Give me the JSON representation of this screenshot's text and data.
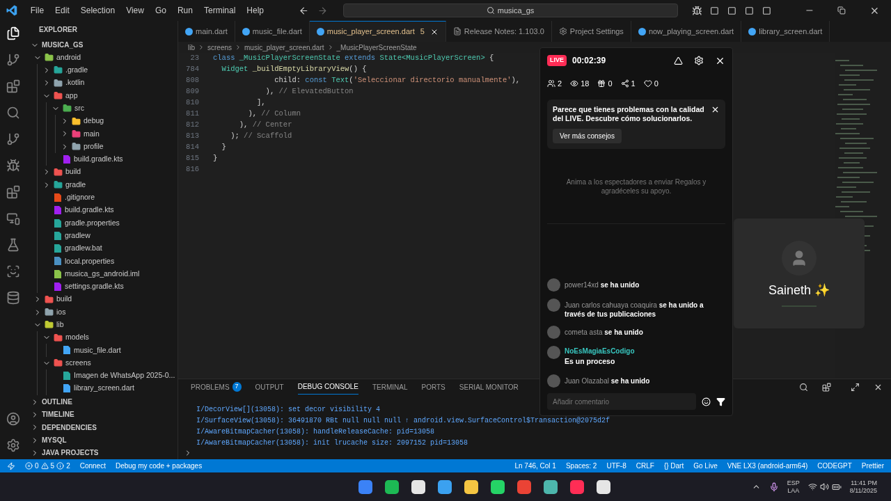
{
  "menu": [
    "File",
    "Edit",
    "Selection",
    "View",
    "Go",
    "Run",
    "Terminal",
    "Help"
  ],
  "search": {
    "value": "musica_gs"
  },
  "tabs": [
    {
      "label": "main.dart",
      "kind": "dart",
      "selected": false
    },
    {
      "label": "music_file.dart",
      "kind": "dart",
      "selected": false
    },
    {
      "label": "music_player_screen.dart",
      "kind": "dart",
      "selected": true,
      "badge": "5"
    },
    {
      "label": "Release Notes: 1.103.0",
      "kind": "doc",
      "selected": false
    },
    {
      "label": "Project Settings",
      "kind": "settings",
      "selected": false
    },
    {
      "label": "now_playing_screen.dart",
      "kind": "dart",
      "selected": false
    },
    {
      "label": "library_screen.dart",
      "kind": "dart",
      "selected": false
    }
  ],
  "explorer": {
    "title": "EXPLORER",
    "root": "MUSICA_GS",
    "tree": [
      {
        "name": "android",
        "kind": "folder",
        "expanded": true,
        "color": "#8bc34a",
        "children": [
          {
            "name": ".gradle",
            "kind": "folder",
            "expanded": false,
            "color": "#26a69a"
          },
          {
            "name": ".kotlin",
            "kind": "folder",
            "expanded": false,
            "color": "#90a4ae"
          },
          {
            "name": "app",
            "kind": "folder",
            "expanded": true,
            "color": "#ef5350",
            "children": [
              {
                "name": "src",
                "kind": "folder",
                "expanded": true,
                "color": "#4caf50",
                "children": [
                  {
                    "name": "debug",
                    "kind": "folder",
                    "expanded": false,
                    "color": "#fbc02d"
                  },
                  {
                    "name": "main",
                    "kind": "folder",
                    "expanded": false,
                    "color": "#ec407a"
                  },
                  {
                    "name": "profile",
                    "kind": "folder",
                    "expanded": false,
                    "color": "#90a4ae"
                  }
                ]
              },
              {
                "name": "build.gradle.kts",
                "kind": "file",
                "color": "#a020f0"
              }
            ]
          },
          {
            "name": "build",
            "kind": "folder",
            "expanded": false,
            "color": "#ef5350"
          },
          {
            "name": "gradle",
            "kind": "folder",
            "expanded": false,
            "color": "#26a69a"
          },
          {
            "name": ".gitignore",
            "kind": "file",
            "color": "#e64a19"
          },
          {
            "name": "build.gradle.kts",
            "kind": "file",
            "color": "#a020f0"
          },
          {
            "name": "gradle.properties",
            "kind": "file",
            "color": "#26a69a"
          },
          {
            "name": "gradlew",
            "kind": "file",
            "color": "#26a69a"
          },
          {
            "name": "gradlew.bat",
            "kind": "file",
            "color": "#26a69a"
          },
          {
            "name": "local.properties",
            "kind": "file",
            "color": "#4a90c2"
          },
          {
            "name": "musica_gs_android.iml",
            "kind": "file",
            "color": "#8bc34a"
          },
          {
            "name": "settings.gradle.kts",
            "kind": "file",
            "color": "#a020f0"
          }
        ]
      },
      {
        "name": "build",
        "kind": "folder",
        "expanded": false,
        "color": "#ef5350"
      },
      {
        "name": "ios",
        "kind": "folder",
        "expanded": false,
        "color": "#90a4ae"
      },
      {
        "name": "lib",
        "kind": "folder",
        "expanded": true,
        "color": "#c0ca33",
        "children": [
          {
            "name": "models",
            "kind": "folder",
            "expanded": true,
            "color": "#ef5350",
            "children": [
              {
                "name": "music_file.dart",
                "kind": "file",
                "color": "#42a5f5"
              }
            ]
          },
          {
            "name": "screens",
            "kind": "folder",
            "expanded": true,
            "color": "#ef5350",
            "children": [
              {
                "name": "Imagen de WhatsApp 2025-0...",
                "kind": "file",
                "color": "#26a69a"
              },
              {
                "name": "library_screen.dart",
                "kind": "file",
                "color": "#42a5f5"
              }
            ]
          }
        ]
      }
    ],
    "sections": [
      "OUTLINE",
      "TIMELINE",
      "DEPENDENCIES",
      "MYSQL",
      "JAVA PROJECTS"
    ]
  },
  "breadcrumb": [
    "lib",
    "screens",
    "music_player_screen.dart",
    "_MusicPlayerScreenState"
  ],
  "code": [
    {
      "number": "23",
      "tokens": [
        {
          "text": "class ",
          "kind": "keyword"
        },
        {
          "text": "_MusicPlayerScreenState ",
          "kind": "type"
        },
        {
          "text": "extends ",
          "kind": "keyword"
        },
        {
          "text": "State<MusicPlayerScreen> ",
          "kind": "type"
        },
        {
          "text": "{",
          "kind": "plain"
        }
      ]
    },
    {
      "number": "784",
      "tokens": [
        {
          "text": "  Widget ",
          "kind": "type"
        },
        {
          "text": "_buildEmptyLibraryView",
          "kind": "func"
        },
        {
          "text": "() {",
          "kind": "plain"
        }
      ]
    },
    {
      "number": "808",
      "tokens": [
        {
          "text": "              child: ",
          "kind": "plain"
        },
        {
          "text": "const ",
          "kind": "keyword"
        },
        {
          "text": "Text",
          "kind": "type"
        },
        {
          "text": "(",
          "kind": "plain"
        },
        {
          "text": "'Seleccionar directorio manualmente'",
          "kind": "string"
        },
        {
          "text": "),",
          "kind": "plain"
        }
      ]
    },
    {
      "number": "809",
      "tokens": [
        {
          "text": "            ), ",
          "kind": "plain"
        },
        {
          "text": "// ElevatedButton",
          "kind": "comment"
        }
      ]
    },
    {
      "number": "810",
      "tokens": [
        {
          "text": "          ],",
          "kind": "plain"
        }
      ]
    },
    {
      "number": "811",
      "tokens": [
        {
          "text": "        ), ",
          "kind": "plain"
        },
        {
          "text": "// Column",
          "kind": "comment"
        }
      ]
    },
    {
      "number": "812",
      "tokens": [
        {
          "text": "      ), ",
          "kind": "plain"
        },
        {
          "text": "// Center",
          "kind": "comment"
        }
      ]
    },
    {
      "number": "813",
      "tokens": [
        {
          "text": "    ); ",
          "kind": "plain"
        },
        {
          "text": "// Scaffold",
          "kind": "comment"
        }
      ]
    },
    {
      "number": "814",
      "tokens": [
        {
          "text": "  }",
          "kind": "plain"
        }
      ]
    },
    {
      "number": "815",
      "tokens": [
        {
          "text": "}",
          "kind": "plain"
        }
      ]
    },
    {
      "number": "816"
    }
  ],
  "panel": {
    "tabs": [
      {
        "label": "PROBLEMS",
        "selected": false,
        "badge": "7"
      },
      {
        "label": "OUTPUT",
        "selected": false
      },
      {
        "label": "DEBUG CONSOLE",
        "selected": true
      },
      {
        "label": "TERMINAL",
        "selected": false
      },
      {
        "label": "PORTS",
        "selected": false
      },
      {
        "label": "SERIAL MONITOR",
        "selected": false
      }
    ],
    "lines": [
      "I/DecorView[](13058): set decor visibility 4",
      "I/SurfaceView(13058): 36491870 RBt null null null ↑ android.view.SurfaceControl$Transaction@2075d2f",
      "I/AwareBitmapCacher(13058): handleReleaseCache: pid=13058",
      "I/AwareBitmapCacher(13058): init lrucache size: 2097152 pid=13058"
    ]
  },
  "status_bar": {
    "errors": "0",
    "warnings": "5",
    "infos": "2",
    "left": [
      "Connect",
      "Debug my code + packages"
    ],
    "right": [
      "Ln 746, Col 1",
      "Spaces: 2",
      "UTF-8",
      "CRLF",
      "{} Dart",
      "Go Live",
      "VNE LX3 (android-arm64)",
      "CODEGPT",
      "Prettier"
    ]
  },
  "live": {
    "badge": "LIVE",
    "timer": "00:02:39",
    "stats": [
      {
        "kind": "users",
        "value": "2"
      },
      {
        "kind": "viewers",
        "value": "18"
      },
      {
        "kind": "gifts",
        "value": "0"
      },
      {
        "kind": "shares",
        "value": "1"
      },
      {
        "kind": "likes",
        "value": "0"
      }
    ],
    "tip": {
      "text": "Parece que tienes problemas con la calidad del LIVE. Descubre cómo solucionarlos.",
      "button": "Ver más consejos"
    },
    "prompt": "Anima a los espectadores a enviar Regalos y agradéceles su apoyo.",
    "messages": [
      {
        "kind": "join",
        "user": "power14xd",
        "text": "se ha unido"
      },
      {
        "kind": "join",
        "user": "Juan carlos cahuaya coaquira",
        "text": "se ha unido a través de tus publicaciones"
      },
      {
        "kind": "join",
        "user": "cometa asta",
        "text": "se ha unido"
      },
      {
        "kind": "comment",
        "user": "NoEsMagiaEsCodigo",
        "text": "Es un proceso"
      },
      {
        "kind": "join",
        "user": "Juan Olazabal",
        "text": "se ha unido"
      }
    ],
    "input": {
      "placeholder": "Añadir comentario"
    }
  },
  "guest_card": {
    "name": "Saineth ✨"
  },
  "taskbar": {
    "language": "ESP",
    "layout": "LAA",
    "time": "11:41 PM",
    "date": "8/11/2025"
  }
}
